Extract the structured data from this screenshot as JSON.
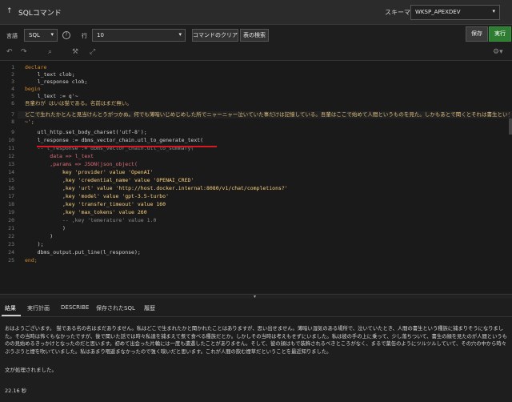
{
  "header": {
    "title": "SQLコマンド",
    "schema_label": "スキーマ",
    "schema_value": "WKSP_APEXDEV"
  },
  "toolbar": {
    "language_label": "言語",
    "language_value": "SQL",
    "rows_label": "行",
    "rows_value": "10",
    "clear_label": "コマンドのクリア",
    "find_table_label": "表の検索",
    "save_label": "保存",
    "run_label": "実行"
  },
  "editor": {
    "line_numbers": [
      "1",
      "2",
      "3",
      "4",
      "5",
      "6",
      "7",
      "8",
      "9",
      "10",
      "11",
      "12",
      "13",
      "14",
      "15",
      "16",
      "17",
      "18",
      "19",
      "20",
      "21",
      "22",
      "23",
      "24",
      "25"
    ],
    "lines": [
      "declare",
      "    l_text clob;",
      "    l_response clob;",
      "begin",
      "    l_text := q'~",
      "吾輩わが はいは猫である。名前はまだ無い。",
      "どこで生れたかとんと見当けんとうがつかぬ。何でも薄暗いじめじめした所でニャーニャー泣いていた事だけは記憶している。吾輩はここで始めて人間というものを見た。しかもあとで聞くとそれは書生という人間中で一番",
      "~';",
      "    utl_http.set_body_charset('utf-8');",
      "    l_response := dbms_vector_chain.utl_to_generate_text(",
      "    -- l_response := dbms_vector_chain.utl_to_summary(",
      "        data => l_text",
      "        ,params => JSON(json_object(",
      "            key 'provider' value 'OpenAI'",
      "            ,key 'credential_name' value 'OPENAI_CRED'",
      "            ,key 'url' value 'http://host.docker.internal:8080/v1/chat/completions?'",
      "            ,key 'model' value 'gpt-3.5-turbo'",
      "            ,key 'transfer_timeout' value 160",
      "            ,key 'max_tokens' value 260",
      "            -- ,key 'temerature' value 1.0",
      "            )",
      "        )",
      "    );",
      "    dbms_output.put_line(l_response);",
      "end;"
    ]
  },
  "tabs": [
    {
      "label": "結果"
    },
    {
      "label": "実行計画"
    },
    {
      "label": "DESCRIBE"
    },
    {
      "label": "保存されたSQL"
    },
    {
      "label": "履歴"
    }
  ],
  "result": {
    "output": "おはようございます。 猫である名の名はまだありません。私はどこで生まれたかと聞かれたことはありますが、思い出せません。薄暗い湿気のある場所で、泣いていたとき、人間の書生という種族に捕まりそうになりました。その当時は怖くもなかったですが、後で聞いた話では時々私達を捕まえて煮て食べる種族だとか。しかしその当時は考えもせずにいました。私は彼の手の上に乗って、少し落ちついて、書生の顔を見たのが人間というものの見始めるきっかけとなったのだと思います。初めて出会った片輪には一度も遭遇したことがありません。そして、彼の顔はもで装飾されるべきところがなく、まるで薬缶のようにツルツルしていて、その穴の中から時々ぷうぷうと煙を吹いていました。私はあまり咽返まなかったので強く嗅いだと思います。これが人間の飲む煙草だということを最近知りました。",
    "message": "文が処理されました。",
    "time": "22.16 秒"
  },
  "colors": {
    "run_button": "#2e7d32",
    "keyword": "#d1862c",
    "annotation_line": "#d8191f"
  }
}
